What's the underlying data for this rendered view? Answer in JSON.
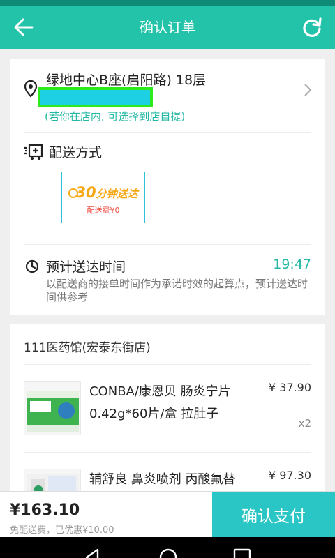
{
  "header": {
    "title": "确认订单",
    "back_icon": "back-arrow-icon",
    "refresh_icon": "refresh-icon"
  },
  "address": {
    "main": "绿地中心B座(启阳路) 18层",
    "hint": "(若你在店内, 可选择到店自提)",
    "pin_icon": "location-pin-icon"
  },
  "delivery": {
    "title": "配送方式",
    "badge_number": "30",
    "badge_text": "分钟送达",
    "fee": "配送费¥0"
  },
  "eta": {
    "title": "预计送达时间",
    "time": "19:47",
    "note": "以配送商的接单时间作为承诺时效的起算点，预计送达时间供参考"
  },
  "store": {
    "name": "111医药馆(宏泰东街店)"
  },
  "products": [
    {
      "name": "CONBA/康恩贝 肠炎宁片 0.42g*60片/盒 拉肚子",
      "price": "¥ 37.90",
      "qty": "x2"
    },
    {
      "name": "辅舒良 鼻炎喷剂 丙酸氟替",
      "price": "¥ 97.30"
    }
  ],
  "bottom": {
    "total": "¥163.10",
    "note": "免配送费，已优惠¥10.00",
    "pay_label": "确认支付"
  },
  "colors": {
    "primary": "#22c3a9",
    "pay": "#29c6c5",
    "accent_text": "#22b8a3",
    "badge": "#f6a713",
    "fee": "#ef4a3f"
  }
}
